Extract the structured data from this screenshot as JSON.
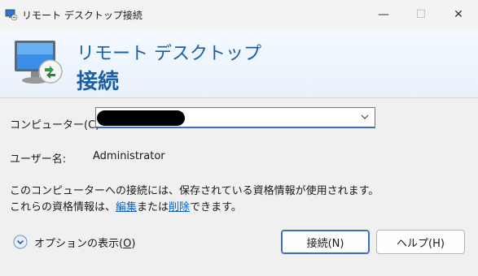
{
  "window": {
    "title": "リモート デスクトップ接続",
    "minimize_glyph": "—",
    "maximize_glyph": "☐",
    "close_glyph": "✕"
  },
  "banner": {
    "line1": "リモート デスクトップ",
    "line2": "接続"
  },
  "form": {
    "computer_label": "コンピューター(C):",
    "computer_value": "",
    "username_label": "ユーザー名:",
    "username_value": "Administrator"
  },
  "info": {
    "line1": "このコンピューターへの接続には、保存されている資格情報が使用されます。",
    "line2_prefix": "これらの資格情報は、",
    "edit_link": "編集",
    "line2_mid": "または",
    "delete_link": "削除",
    "line2_suffix": "できます。"
  },
  "options": {
    "label_prefix": "オプションの表示(",
    "label_key": "O",
    "label_suffix": ")"
  },
  "buttons": {
    "connect": "接続(N)",
    "help": "ヘルプ(H)"
  },
  "colors": {
    "accent": "#1a5ea8",
    "link": "#0b63c4"
  }
}
